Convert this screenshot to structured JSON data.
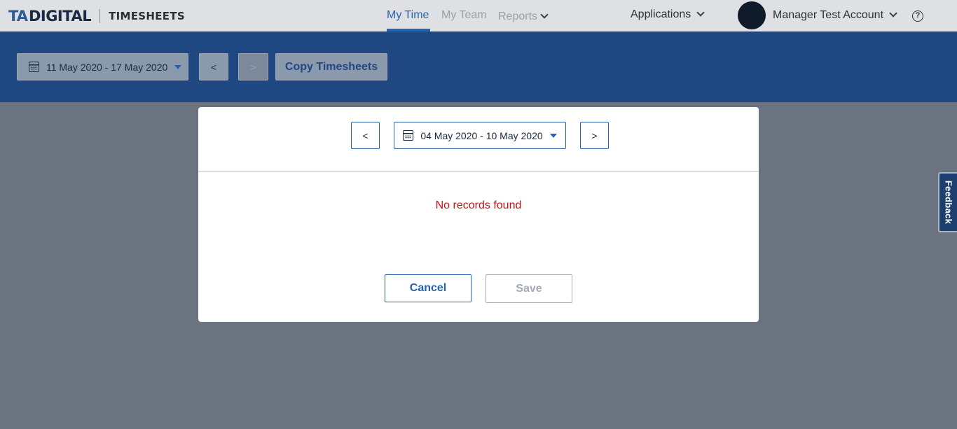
{
  "header": {
    "logo_ta": "TA",
    "logo_digital": "DIGITAL",
    "product": "TIMESHEETS",
    "nav": {
      "my_time": "My Time",
      "my_team": "My Team",
      "reports": "Reports"
    },
    "applications": "Applications",
    "account_name": "Manager Test Account",
    "help": "?"
  },
  "toolbar": {
    "date_range": "11 May 2020 - 17 May 2020",
    "prev": "<",
    "next": ">",
    "copy": "Copy Timesheets"
  },
  "modal": {
    "prev": "<",
    "date_range": "04 May 2020 - 10 May 2020",
    "next": ">",
    "empty_message": "No records found",
    "cancel": "Cancel",
    "save": "Save"
  },
  "feedback": "Feedback",
  "colors": {
    "accent": "#2563b0",
    "brand_bar": "#1f4882",
    "error": "#c41414",
    "overlay": "#6b7280"
  }
}
